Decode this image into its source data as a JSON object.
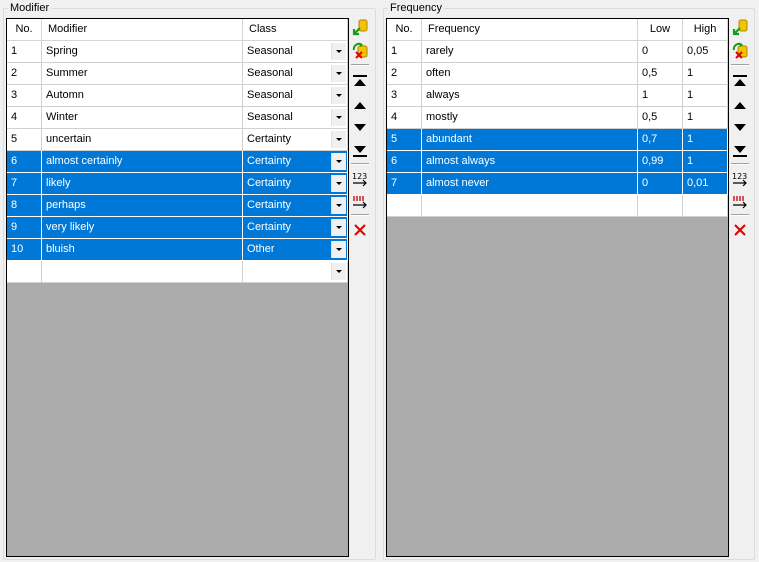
{
  "modifier_panel": {
    "title": "Modifier",
    "columns": [
      "No.",
      "Modifier",
      "Class"
    ],
    "rows": [
      {
        "no": "1",
        "modifier": "Spring",
        "class": "Seasonal",
        "selected": false
      },
      {
        "no": "2",
        "modifier": "Summer",
        "class": "Seasonal",
        "selected": false
      },
      {
        "no": "3",
        "modifier": "Automn",
        "class": "Seasonal",
        "selected": false
      },
      {
        "no": "4",
        "modifier": "Winter",
        "class": "Seasonal",
        "selected": false
      },
      {
        "no": "5",
        "modifier": "uncertain",
        "class": "Certainty",
        "selected": false
      },
      {
        "no": "6",
        "modifier": "almost certainly",
        "class": "Certainty",
        "selected": true
      },
      {
        "no": "7",
        "modifier": "likely",
        "class": "Certainty",
        "selected": true
      },
      {
        "no": "8",
        "modifier": "perhaps",
        "class": "Certainty",
        "selected": true
      },
      {
        "no": "9",
        "modifier": "very likely",
        "class": "Certainty",
        "selected": true
      },
      {
        "no": "10",
        "modifier": "bluish",
        "class": "Other",
        "selected": true
      },
      {
        "no": "",
        "modifier": "",
        "class": "",
        "selected": false
      }
    ]
  },
  "frequency_panel": {
    "title": "Frequency",
    "columns": [
      "No.",
      "Frequency",
      "Low",
      "High"
    ],
    "rows": [
      {
        "no": "1",
        "frequency": "rarely",
        "low": "0",
        "high": "0,05",
        "selected": false
      },
      {
        "no": "2",
        "frequency": "often",
        "low": "0,5",
        "high": "1",
        "selected": false
      },
      {
        "no": "3",
        "frequency": "always",
        "low": "1",
        "high": "1",
        "selected": false
      },
      {
        "no": "4",
        "frequency": "mostly",
        "low": "0,5",
        "high": "1",
        "selected": false
      },
      {
        "no": "5",
        "frequency": "abundant",
        "low": "0,7",
        "high": "1",
        "selected": true
      },
      {
        "no": "6",
        "frequency": "almost always",
        "low": "0,99",
        "high": "1",
        "selected": true
      },
      {
        "no": "7",
        "frequency": "almost never",
        "low": "0",
        "high": "0,01",
        "selected": true
      },
      {
        "no": "",
        "frequency": "",
        "low": "",
        "high": "",
        "selected": false
      }
    ]
  },
  "toolbar_icons": [
    "import-icon",
    "refresh-icon",
    "move-first-icon",
    "move-up-icon",
    "move-down-icon",
    "move-last-icon",
    "renumber-icon",
    "sort-icon",
    "delete-icon"
  ],
  "colors": {
    "selection": "#0078d7",
    "grid_background": "#ababab",
    "delete": "#e00000"
  }
}
